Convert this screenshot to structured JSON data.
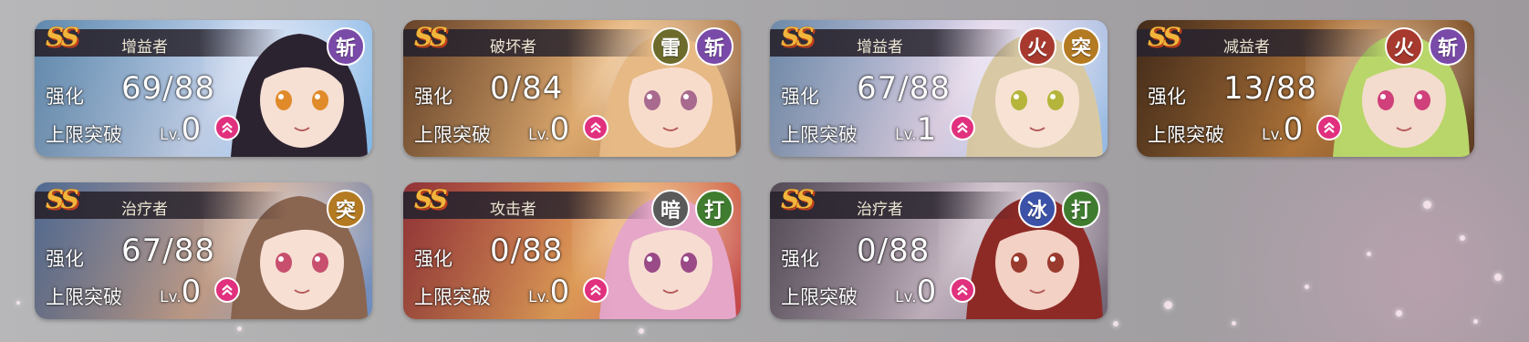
{
  "labels": {
    "enhance": "强化",
    "limit_break": "上限突破",
    "lv_prefix": "Lv."
  },
  "element_colors": {
    "斩": "#7a4aa8",
    "雷": "#6c6b2c",
    "火": "#a8392f",
    "突": "#b47a22",
    "暗": "#5a5a5a",
    "打": "#3f7c2f",
    "冰": "#3b52a8"
  },
  "cards": [
    {
      "rank": "SS",
      "role": "增益者",
      "enhance": "69/88",
      "level": "0",
      "badges": [
        "斩"
      ],
      "theme": {
        "bg1": "#7fb6e6",
        "bg2": "#c9d7f0",
        "hair": "#2c2330",
        "skin": "#f6dfd3",
        "eye": "#e08a2a"
      }
    },
    {
      "rank": "SS",
      "role": "破坏者",
      "enhance": "0/84",
      "level": "0",
      "badges": [
        "雷",
        "斩"
      ],
      "theme": {
        "bg1": "#8a5a38",
        "bg2": "#e8b274",
        "hair": "#e6b985",
        "skin": "#f8dccb",
        "eye": "#a86a8e"
      }
    },
    {
      "rank": "SS",
      "role": "增益者",
      "enhance": "67/88",
      "level": "1",
      "badges": [
        "火",
        "突"
      ],
      "theme": {
        "bg1": "#92b8e2",
        "bg2": "#e4d6ea",
        "hair": "#d8c9a4",
        "skin": "#f7e2d4",
        "eye": "#b4b53a"
      }
    },
    {
      "rank": "SS",
      "role": "减益者",
      "enhance": "13/88",
      "level": "0",
      "badges": [
        "火",
        "斩"
      ],
      "theme": {
        "bg1": "#5a3a22",
        "bg2": "#b87a3c",
        "hair": "#b9d66a",
        "skin": "#f3dccd",
        "eye": "#d0407a"
      }
    },
    {
      "rank": "SS",
      "role": "治疗者",
      "enhance": "67/88",
      "level": "0",
      "badges": [
        "突"
      ],
      "theme": {
        "bg1": "#6a8cc2",
        "bg2": "#c8a28c",
        "hair": "#8a6550",
        "skin": "#f7dfd4",
        "eye": "#c84f6e"
      }
    },
    {
      "rank": "SS",
      "role": "攻击者",
      "enhance": "0/88",
      "level": "0",
      "badges": [
        "暗",
        "打"
      ],
      "theme": {
        "bg1": "#c2434a",
        "bg2": "#e7a25a",
        "hair": "#e5a6c8",
        "skin": "#f7dcd2",
        "eye": "#9a4a86"
      }
    },
    {
      "rank": "SS",
      "role": "治疗者",
      "enhance": "0/88",
      "level": "0",
      "badges": [
        "冰",
        "打"
      ],
      "theme": {
        "bg1": "#6e6272",
        "bg2": "#c9b9c6",
        "hair": "#8e2a26",
        "skin": "#f3d1c4",
        "eye": "#9a3a2e"
      }
    }
  ]
}
